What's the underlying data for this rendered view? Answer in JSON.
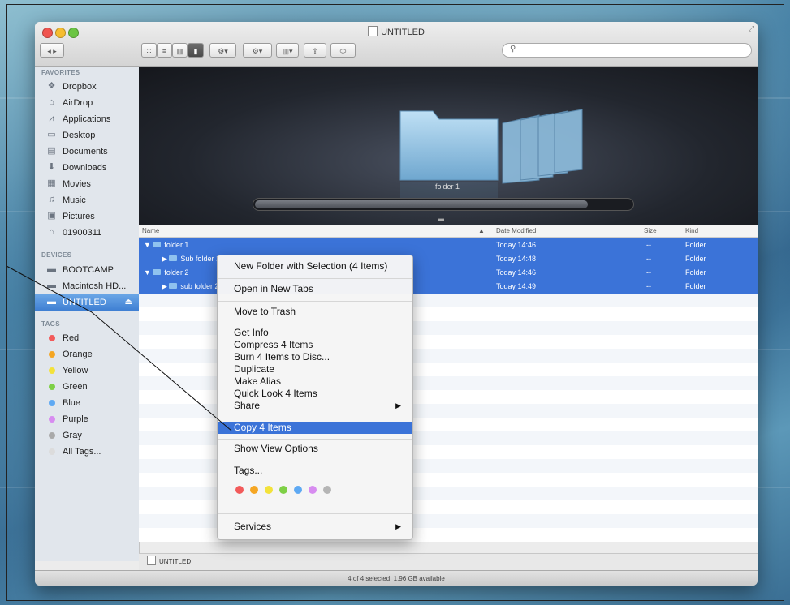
{
  "window": {
    "title": "UNTITLED"
  },
  "toolbar": {
    "view_icons": [
      "icon-view-icon",
      "list-view-icon",
      "column-view-icon",
      "coverflow-view-icon"
    ],
    "action_label": "⚙▾",
    "arrange_label": "⚙▾",
    "share_label": "⇪"
  },
  "sidebar": {
    "favorites_label": "FAVORITES",
    "favorites": [
      {
        "label": "Dropbox",
        "icon": "dropbox-icon"
      },
      {
        "label": "AirDrop",
        "icon": "airdrop-icon"
      },
      {
        "label": "Applications",
        "icon": "applications-icon"
      },
      {
        "label": "Desktop",
        "icon": "desktop-icon"
      },
      {
        "label": "Documents",
        "icon": "documents-icon"
      },
      {
        "label": "Downloads",
        "icon": "downloads-icon"
      },
      {
        "label": "Movies",
        "icon": "movies-icon"
      },
      {
        "label": "Music",
        "icon": "music-icon"
      },
      {
        "label": "Pictures",
        "icon": "pictures-icon"
      },
      {
        "label": "01900311",
        "icon": "home-icon"
      }
    ],
    "devices_label": "DEVICES",
    "devices": [
      {
        "label": "BOOTCAMP",
        "icon": "disk-icon"
      },
      {
        "label": "Macintosh HD...",
        "icon": "disk-icon"
      },
      {
        "label": "UNTITLED",
        "icon": "disk-icon",
        "selected": true
      }
    ],
    "tags_label": "TAGS",
    "tags": [
      {
        "label": "Red",
        "color": "#f25a5a"
      },
      {
        "label": "Orange",
        "color": "#f5a623"
      },
      {
        "label": "Yellow",
        "color": "#f3e23a"
      },
      {
        "label": "Green",
        "color": "#7ed046"
      },
      {
        "label": "Blue",
        "color": "#5ea9f3"
      },
      {
        "label": "Purple",
        "color": "#d78cf0"
      },
      {
        "label": "Gray",
        "color": "#a9a9a9"
      },
      {
        "label": "All Tags...",
        "color": "#dcdcdc"
      }
    ]
  },
  "coverflow": {
    "label": "folder 1"
  },
  "list": {
    "columns": {
      "name": "Name",
      "date": "Date Modified",
      "size": "Size",
      "kind": "Kind"
    },
    "rows": [
      {
        "name": "folder 1",
        "date": "Today 14:46",
        "size": "--",
        "kind": "Folder",
        "indent": 0,
        "expanded": true
      },
      {
        "name": "Sub folder 1",
        "date": "Today 14:48",
        "size": "--",
        "kind": "Folder",
        "indent": 1,
        "expanded": false
      },
      {
        "name": "folder 2",
        "date": "Today 14:46",
        "size": "--",
        "kind": "Folder",
        "indent": 0,
        "expanded": true
      },
      {
        "name": "sub folder 2",
        "date": "Today 14:49",
        "size": "--",
        "kind": "Folder",
        "indent": 1,
        "expanded": false
      }
    ]
  },
  "pathbar": {
    "label": "UNTITLED"
  },
  "status": {
    "text": "4 of 4 selected, 1.96 GB available"
  },
  "context_menu": {
    "new_folder": "New Folder with Selection (4 Items)",
    "open_tabs": "Open in New Tabs",
    "trash": "Move to Trash",
    "get_info": "Get Info",
    "compress": "Compress 4 Items",
    "burn": "Burn 4 Items to Disc...",
    "duplicate": "Duplicate",
    "alias": "Make Alias",
    "quicklook": "Quick Look 4 Items",
    "share": "Share",
    "copy": "Copy 4 Items",
    "view_options": "Show View Options",
    "tags": "Tags...",
    "tag_colors": [
      "#f25a5a",
      "#f5a623",
      "#f3e23a",
      "#7ed046",
      "#5ea9f3",
      "#d78cf0",
      "#b5b5b5"
    ],
    "services": "Services"
  }
}
